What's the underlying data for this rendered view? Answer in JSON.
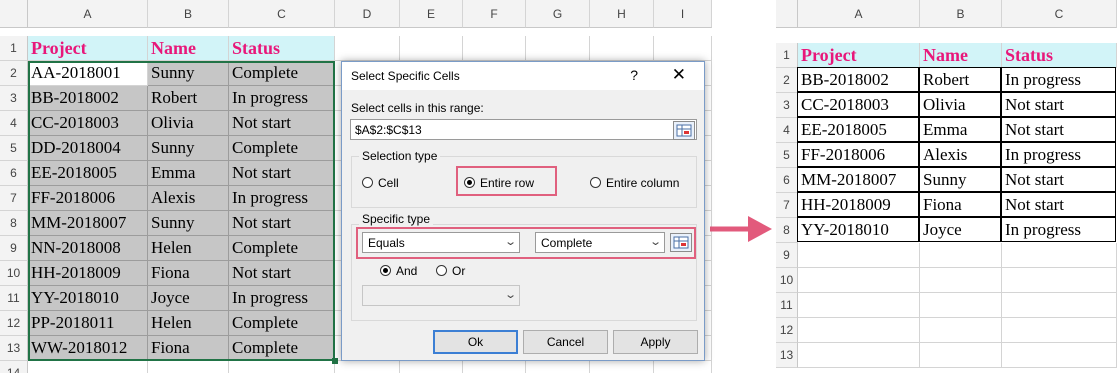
{
  "left_sheet": {
    "columns": [
      "A",
      "B",
      "C",
      "D",
      "E",
      "F",
      "G",
      "H",
      "I"
    ],
    "row_numbers": [
      "1",
      "2",
      "3",
      "4",
      "5",
      "6",
      "7",
      "8",
      "9",
      "10",
      "11",
      "12",
      "13",
      "14"
    ],
    "headers": [
      "Project",
      "Name",
      "Status"
    ],
    "rows": [
      [
        "AA-2018001",
        "Sunny",
        "Complete"
      ],
      [
        "BB-2018002",
        "Robert",
        "In progress"
      ],
      [
        "CC-2018003",
        "Olivia",
        "Not start"
      ],
      [
        "DD-2018004",
        "Sunny",
        "Complete"
      ],
      [
        "EE-2018005",
        "Emma",
        "Not start"
      ],
      [
        "FF-2018006",
        "Alexis",
        "In progress"
      ],
      [
        "MM-2018007",
        "Sunny",
        "Not start"
      ],
      [
        "NN-2018008",
        "Helen",
        "Complete"
      ],
      [
        "HH-2018009",
        "Fiona",
        "Not start"
      ],
      [
        "YY-2018010",
        "Joyce",
        "In progress"
      ],
      [
        "PP-2018011",
        "Helen",
        "Complete"
      ],
      [
        "WW-2018012",
        "Fiona",
        "Complete"
      ]
    ]
  },
  "dialog": {
    "title": "Select Specific Cells",
    "help_icon": "?",
    "close_icon": "✕",
    "range_label": "Select cells in this range:",
    "range_value": "$A$2:$C$13",
    "selection_type_label": "Selection type",
    "selection_options": [
      "Cell",
      "Entire row",
      "Entire column"
    ],
    "selected_option": "Entire row",
    "specific_type_label": "Specific type",
    "operator": "Equals",
    "criteria_value": "Complete",
    "logic_options": [
      "And",
      "Or"
    ],
    "selected_logic": "And",
    "second_operator": "",
    "buttons": {
      "ok": "Ok",
      "cancel": "Cancel",
      "apply": "Apply"
    }
  },
  "arrow_color": "#e25a7c",
  "right_sheet": {
    "columns": [
      "A",
      "B",
      "C"
    ],
    "row_numbers": [
      "1",
      "2",
      "3",
      "4",
      "5",
      "6",
      "7",
      "8",
      "9",
      "10",
      "11",
      "12",
      "13"
    ],
    "headers": [
      "Project",
      "Name",
      "Status"
    ],
    "rows": [
      [
        "BB-2018002",
        "Robert",
        "In progress"
      ],
      [
        "CC-2018003",
        "Olivia",
        "Not start"
      ],
      [
        "EE-2018005",
        "Emma",
        "Not start"
      ],
      [
        "FF-2018006",
        "Alexis",
        "In progress"
      ],
      [
        "MM-2018007",
        "Sunny",
        "Not start"
      ],
      [
        "HH-2018009",
        "Fiona",
        "Not start"
      ],
      [
        "YY-2018010",
        "Joyce",
        "In progress"
      ]
    ]
  }
}
